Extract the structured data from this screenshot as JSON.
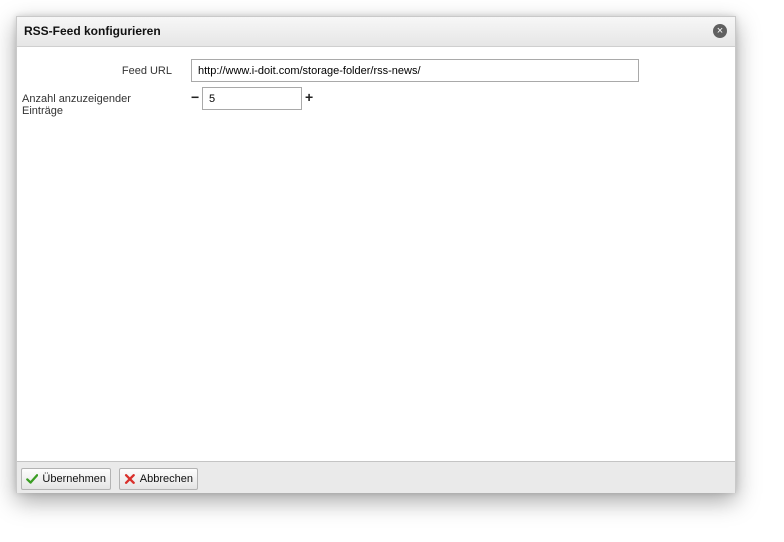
{
  "dialog": {
    "title": "RSS-Feed konfigurieren",
    "close_icon": "close-icon"
  },
  "form": {
    "feed_url_label": "Feed URL",
    "feed_url_value": "http://www.i-doit.com/storage-folder/rss-news/",
    "count_label": "Anzahl anzuzeigender Einträge",
    "count_value": "5",
    "decrement_symbol": "−",
    "increment_symbol": "+"
  },
  "footer": {
    "accept_label": "Übernehmen",
    "accept_icon": "checkmark-icon",
    "cancel_label": "Abbrechen",
    "cancel_icon": "red-x-icon"
  },
  "colors": {
    "accept_icon": "#3a9d23",
    "cancel_icon": "#d9302b"
  }
}
